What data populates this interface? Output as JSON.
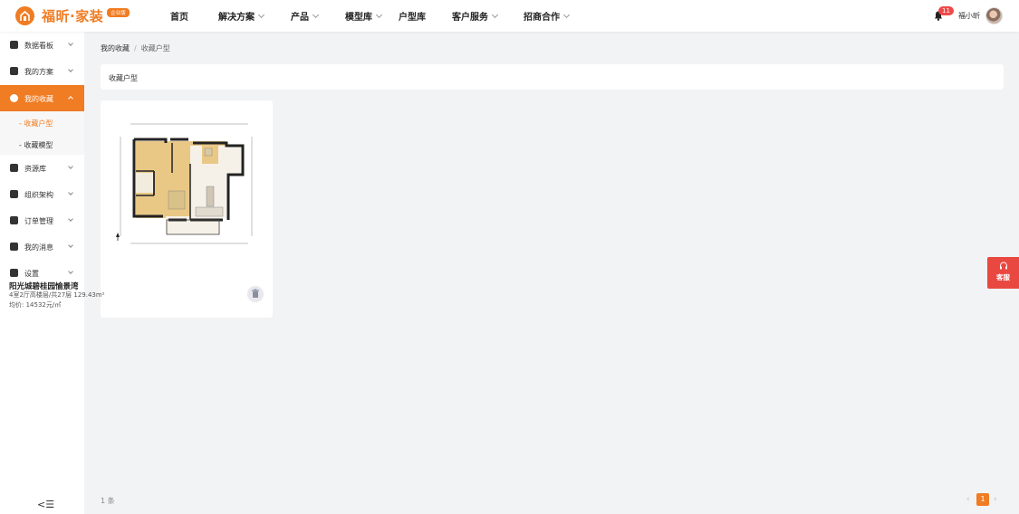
{
  "brand": {
    "name": "福昕·家装",
    "badge": "企业版",
    "color": "#f07c23"
  },
  "nav": [
    {
      "label": "首页",
      "dropdown": false
    },
    {
      "label": "解决方案",
      "dropdown": true
    },
    {
      "label": "产品",
      "dropdown": true
    },
    {
      "label": "模型库",
      "dropdown": true
    },
    {
      "label": "户型库",
      "dropdown": false
    },
    {
      "label": "客户服务",
      "dropdown": true
    },
    {
      "label": "招商合作",
      "dropdown": true
    }
  ],
  "user": {
    "notifications": "11",
    "name": "福小昕"
  },
  "sidebar": {
    "items": [
      {
        "label": "数据看板",
        "icon": "dashboard-icon"
      },
      {
        "label": "我的方案",
        "icon": "document-icon"
      },
      {
        "label": "我的收藏",
        "icon": "star-icon"
      },
      {
        "label": "资源库",
        "icon": "resource-icon"
      },
      {
        "label": "组织架构",
        "icon": "org-icon"
      },
      {
        "label": "订单管理",
        "icon": "clipboard-icon"
      },
      {
        "label": "我的消息",
        "icon": "bell-icon"
      },
      {
        "label": "设置",
        "icon": "gear-icon"
      }
    ],
    "sub": [
      {
        "label": "- 收藏户型"
      },
      {
        "label": "- 收藏模型"
      }
    ],
    "collapse_glyph": "<☰"
  },
  "breadcrumb": {
    "parent": "我的收藏",
    "separator": "/",
    "current": "收藏户型"
  },
  "section_title": "收藏户型",
  "card": {
    "title": "阳光城碧桂园愉景湾",
    "info": "4室2厅高楼层/共27层 129.43m²",
    "price": "均价: 14532元/㎡"
  },
  "footer": {
    "count": "1 条",
    "page": "1",
    "prev": "‹",
    "next": "›"
  },
  "service": {
    "label": "客服"
  }
}
